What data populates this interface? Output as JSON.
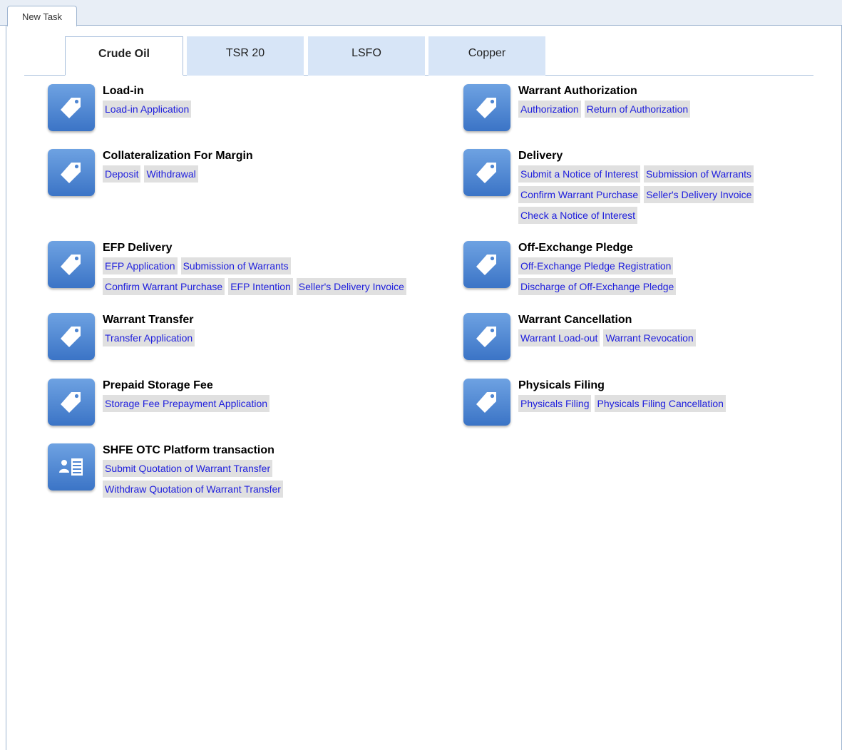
{
  "window": {
    "tab_label": "New Task"
  },
  "commodity_tabs": [
    "Crude Oil",
    "TSR 20",
    "LSFO",
    "Copper"
  ],
  "active_tab": "Crude Oil",
  "colors": {
    "tile": "#3b74c6",
    "tab_bg": "#d7e5f7",
    "link": "#2020dd",
    "link_bg": "#e0e0e0"
  },
  "groups": [
    {
      "title": "Load-in",
      "icon": "tag-icon",
      "links": [
        [
          "Load-in Application"
        ]
      ]
    },
    {
      "title": "Warrant Authorization",
      "icon": "tag-icon",
      "links": [
        [
          "Authorization",
          "Return of Authorization"
        ]
      ]
    },
    {
      "title": "Collateralization For Margin",
      "icon": "tag-icon",
      "links": [
        [
          "Deposit",
          "Withdrawal"
        ]
      ]
    },
    {
      "title": "Delivery",
      "icon": "tag-icon",
      "links": [
        [
          "Submit a Notice of Interest",
          "Submission of Warrants"
        ],
        [
          "Confirm Warrant Purchase",
          "Seller's Delivery Invoice"
        ],
        [
          "Check a Notice of Interest"
        ]
      ]
    },
    {
      "title": "EFP Delivery",
      "icon": "tag-icon",
      "links": [
        [
          "EFP Application",
          "Submission of Warrants"
        ],
        [
          "Confirm Warrant Purchase",
          "EFP Intention",
          "Seller's Delivery Invoice"
        ]
      ]
    },
    {
      "title": "Off-Exchange Pledge",
      "icon": "tag-icon",
      "links": [
        [
          "Off-Exchange Pledge Registration"
        ],
        [
          "Discharge of Off-Exchange Pledge"
        ]
      ]
    },
    {
      "title": "Warrant Transfer",
      "icon": "tag-icon",
      "links": [
        [
          "Transfer Application"
        ]
      ]
    },
    {
      "title": "Warrant Cancellation",
      "icon": "tag-icon",
      "links": [
        [
          "Warrant Load-out",
          "Warrant Revocation"
        ]
      ]
    },
    {
      "title": "Prepaid Storage Fee",
      "icon": "tag-icon",
      "links": [
        [
          "Storage Fee Prepayment Application"
        ]
      ]
    },
    {
      "title": "Physicals Filing",
      "icon": "tag-icon",
      "links": [
        [
          "Physicals Filing",
          "Physicals Filing Cancellation"
        ]
      ]
    },
    {
      "title": "SHFE OTC Platform transaction",
      "icon": "contact-card-icon",
      "links": [
        [
          "Submit Quotation of Warrant Transfer"
        ],
        [
          "Withdraw Quotation of Warrant Transfer"
        ]
      ]
    }
  ]
}
